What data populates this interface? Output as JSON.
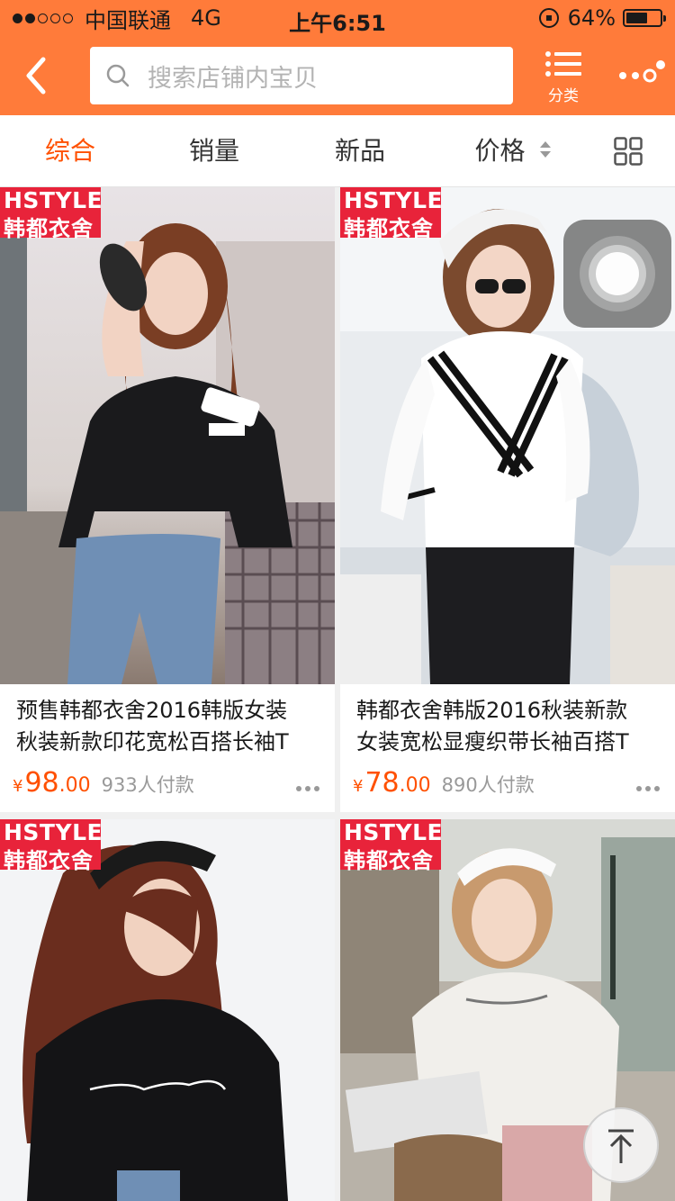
{
  "status_bar": {
    "carrier": "中国联通",
    "network": "4G",
    "time": "上午6:51",
    "battery": "64%",
    "signal_bars_filled": 2,
    "signal_bars_total": 5,
    "battery_level": 0.64
  },
  "navbar": {
    "search_placeholder": "搜索店铺内宝贝",
    "category_label": "分类"
  },
  "sort_tabs": [
    {
      "label": "综合",
      "active": true
    },
    {
      "label": "销量",
      "active": false
    },
    {
      "label": "新品",
      "active": false
    },
    {
      "label": "价格",
      "active": false
    }
  ],
  "badge": {
    "top": "HSTYLE",
    "bottom": "韩都衣舍"
  },
  "products": [
    {
      "title": "预售韩都衣舍2016韩版女装秋装新款印花宽松百搭长袖T",
      "title_line1": "预售韩都衣舍2016韩版女装",
      "title_line2": "秋装新款印花宽松百搭长袖T",
      "currency": "¥",
      "price_int": "98",
      "price_dec": ".00",
      "sold": "933人付款"
    },
    {
      "title": "韩都衣舍韩版2016秋装新款女装宽松显瘦织带长袖百搭T",
      "title_line1": "韩都衣舍韩版2016秋装新款",
      "title_line2": "女装宽松显瘦织带长袖百搭T",
      "currency": "¥",
      "price_int": "78",
      "price_dec": ".00",
      "sold": "890人付款"
    },
    {
      "title": ""
    },
    {
      "title": ""
    }
  ],
  "colors": {
    "brand": "#ff7b3a",
    "price": "#ff5000",
    "badge": "#e8233a"
  },
  "icons": [
    "back-arrow-icon",
    "search-icon",
    "list-icon",
    "more-icon",
    "sort-arrows-icon",
    "grid-view-icon",
    "back-to-top-icon"
  ]
}
